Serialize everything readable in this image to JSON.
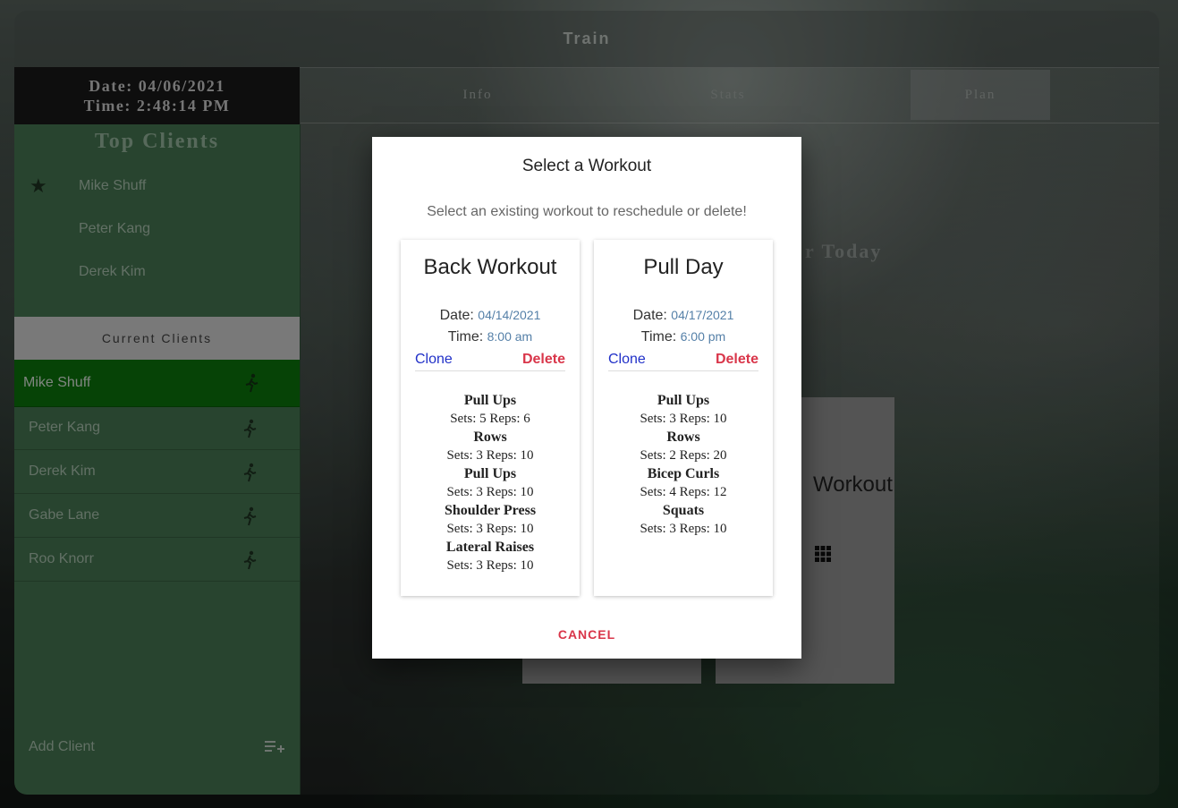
{
  "app": {
    "title": "Train"
  },
  "datetime": {
    "date": "Date: 04/06/2021",
    "time": "Time: 2:48:14 PM"
  },
  "tabs": [
    {
      "label": "Info",
      "active": false
    },
    {
      "label": "Stats",
      "active": false
    },
    {
      "label": "Plan",
      "active": true
    }
  ],
  "sidebar": {
    "top_title": "Top Clients",
    "top_clients": [
      "Mike Shuff",
      "Peter Kang",
      "Derek Kim"
    ],
    "current_title": "Current Clients",
    "current_clients": [
      "Mike Shuff",
      "Peter Kang",
      "Derek Kim",
      "Gabe Lane",
      "Roo Knorr"
    ],
    "selected_client": "Mike Shuff",
    "add_client": "Add Client"
  },
  "background": {
    "title_fragment": "r Today",
    "card_fragment": "Workout"
  },
  "dialog": {
    "title": "Select a Workout",
    "subtitle": "Select an existing workout to reschedule or delete!",
    "cancel_label": "CANCEL",
    "date_label": "Date: ",
    "time_label": "Time: ",
    "clone_label": "Clone",
    "delete_label": "Delete",
    "workouts": [
      {
        "name": "Back Workout",
        "date": "04/14/2021",
        "time": "8:00 am",
        "exercises": [
          {
            "name": "Pull Ups",
            "sets": "Sets: 5 Reps: 6"
          },
          {
            "name": "Rows",
            "sets": "Sets: 3 Reps: 10"
          },
          {
            "name": "Pull Ups",
            "sets": "Sets: 3 Reps: 10"
          },
          {
            "name": "Shoulder Press",
            "sets": "Sets: 3 Reps: 10"
          },
          {
            "name": "Lateral Raises",
            "sets": "Sets: 3 Reps: 10"
          }
        ]
      },
      {
        "name": "Pull Day",
        "date": "04/17/2021",
        "time": "6:00 pm",
        "exercises": [
          {
            "name": "Pull Ups",
            "sets": "Sets: 3 Reps: 10"
          },
          {
            "name": "Rows",
            "sets": "Sets: 2 Reps: 20"
          },
          {
            "name": "Bicep Curls",
            "sets": "Sets: 4 Reps: 12"
          },
          {
            "name": "Squats",
            "sets": "Sets: 3 Reps: 10"
          }
        ]
      }
    ]
  },
  "colors": {
    "sidebar": "#4a7d56",
    "selected": "#0b7a0b",
    "delete": "#d9364a",
    "clone": "#2030c8"
  }
}
